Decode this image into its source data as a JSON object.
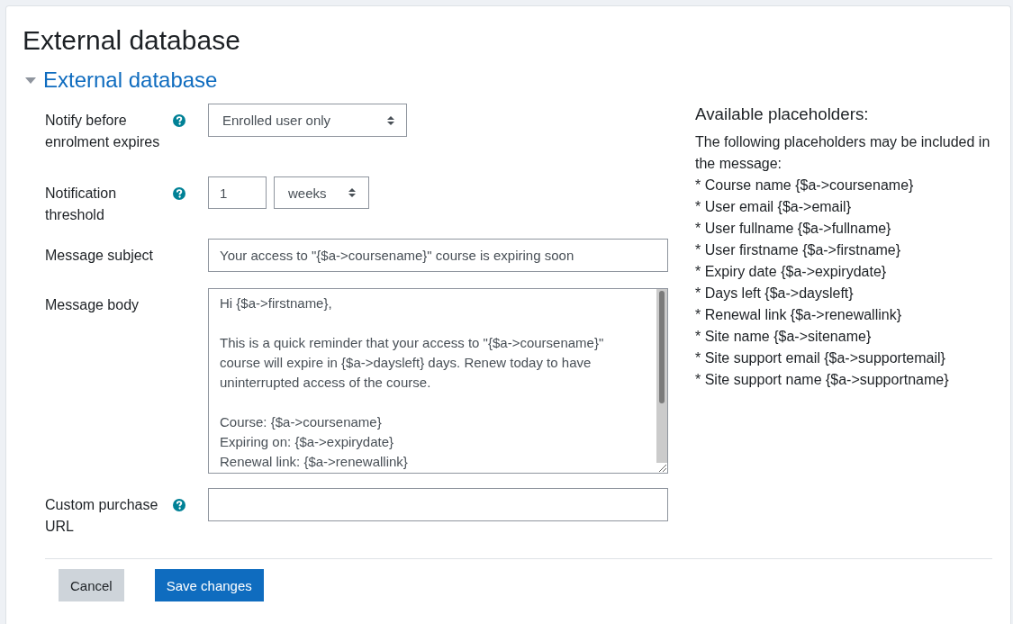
{
  "page": {
    "title": "External database"
  },
  "section": {
    "title": "External database",
    "expanded": true
  },
  "fields": [
    {
      "kind": "select",
      "label": "Notify before enrolment expires",
      "help": true,
      "value": "Enrolled user only"
    },
    {
      "kind": "duration",
      "label": "Notification threshold",
      "help": true,
      "value": "1",
      "unit": "weeks"
    },
    {
      "kind": "text",
      "label": "Message subject",
      "help": false,
      "value": "Your access to \"{$a->coursename}\" course is expiring soon"
    },
    {
      "kind": "textarea",
      "label": "Message body",
      "help": false,
      "value": "Hi {$a->firstname},\n\nThis is a quick reminder that your access to \"{$a->coursename}\" course will expire in {$a->daysleft} days. Renew today to have uninterrupted access of the course.\n\nCourse: {$a->coursename}\nExpiring on: {$a->expirydate}\nRenewal link: {$a->renewallink}"
    },
    {
      "kind": "text",
      "label": "Custom purchase URL",
      "help": true
    }
  ],
  "placeholders": {
    "title": "Available placeholders:",
    "intro": "The following placeholders may be included in the message:",
    "items": [
      "* Course name {$a->coursename}",
      "* User email {$a->email}",
      "* User fullname {$a->fullname}",
      "* User firstname {$a->firstname}",
      "* Expiry date {$a->expirydate}",
      "* Days left {$a->daysleft}",
      "* Renewal link {$a->renewallink}",
      "* Site name {$a->sitename}",
      "* Site support email {$a->supportemail}",
      "* Site support name {$a->supportname}"
    ]
  },
  "buttons": [
    {
      "label": "Cancel",
      "kind": "secondary"
    },
    {
      "label": "Save changes",
      "kind": "primary"
    }
  ]
}
